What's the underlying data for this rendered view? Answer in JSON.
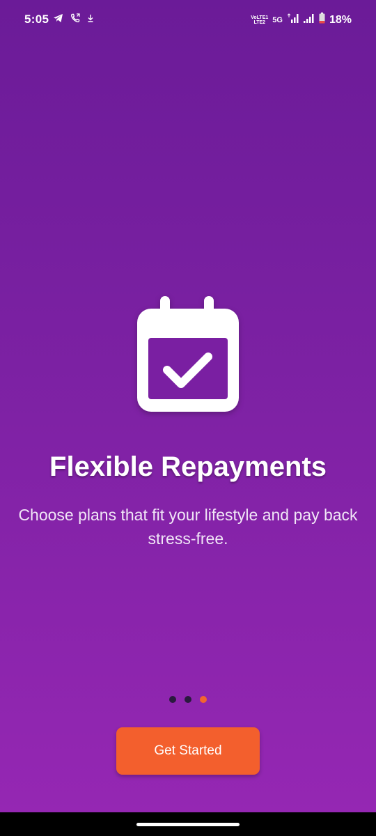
{
  "status_bar": {
    "time": "5:05",
    "left_icons": [
      "telegram-icon",
      "call-icon",
      "download-icon"
    ],
    "volte_top": "VoLTE1",
    "volte_bottom": "LTE2",
    "network": "5G",
    "battery_percent": "18%"
  },
  "onboarding": {
    "icon": "calendar-check-icon",
    "title": "Flexible Repayments",
    "subtitle": "Choose plans that fit your lifestyle and pay back stress-free.",
    "page_count": 3,
    "active_page": 3
  },
  "cta": {
    "label": "Get Started"
  },
  "colors": {
    "background_top": "#6b1b98",
    "background_bottom": "#9527b3",
    "accent": "#f35f2d",
    "dot_inactive": "#2a1a3f"
  }
}
